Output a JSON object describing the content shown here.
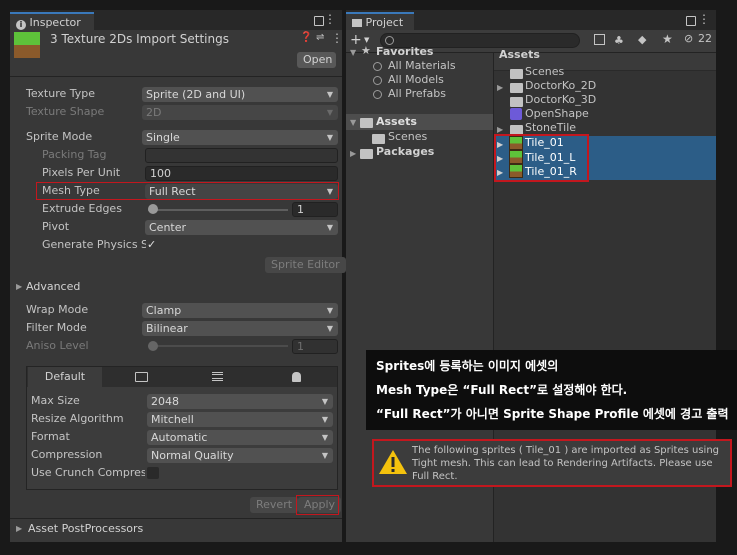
{
  "inspector": {
    "tab_label": "Inspector",
    "header_title": "3 Texture 2Ds Import Settings",
    "open_button": "Open",
    "rows": {
      "texture_type": {
        "label": "Texture Type",
        "value": "Sprite (2D and UI)"
      },
      "texture_shape": {
        "label": "Texture Shape",
        "value": "2D"
      },
      "sprite_mode": {
        "label": "Sprite Mode",
        "value": "Single"
      },
      "packing_tag": {
        "label": "Packing Tag",
        "value": ""
      },
      "pixels_per_unit": {
        "label": "Pixels Per Unit",
        "value": "100"
      },
      "mesh_type": {
        "label": "Mesh Type",
        "value": "Full Rect"
      },
      "extrude_edges": {
        "label": "Extrude Edges",
        "value": "1",
        "slider_fraction": 0.0
      },
      "pivot": {
        "label": "Pivot",
        "value": "Center"
      },
      "generate_physics": {
        "label": "Generate Physics S",
        "checked": true
      }
    },
    "sprite_editor_button": "Sprite Editor",
    "advanced_label": "Advanced",
    "wrap_mode": {
      "label": "Wrap Mode",
      "value": "Clamp"
    },
    "filter_mode": {
      "label": "Filter Mode",
      "value": "Bilinear"
    },
    "aniso_level": {
      "label": "Aniso Level",
      "value": "1",
      "slider_fraction": 0.0
    },
    "platform_tabs": {
      "default_label": "Default",
      "icons": [
        "monitor-icon",
        "server-icon",
        "android-icon"
      ]
    },
    "max_size": {
      "label": "Max Size",
      "value": "2048"
    },
    "resize_algorithm": {
      "label": "Resize Algorithm",
      "value": "Mitchell"
    },
    "format": {
      "label": "Format",
      "value": "Automatic"
    },
    "compression": {
      "label": "Compression",
      "value": "Normal Quality"
    },
    "crunch": {
      "label": "Use Crunch Compress",
      "checked": false
    },
    "revert_button": "Revert",
    "apply_button": "Apply",
    "post_processors_label": "Asset PostProcessors"
  },
  "project": {
    "tab_label": "Project",
    "add_label": "+",
    "hidden_count": "22",
    "favorites": {
      "title": "Favorites",
      "items": [
        "All Materials",
        "All Models",
        "All Prefabs"
      ]
    },
    "tree": {
      "assets": "Assets",
      "scenes": "Scenes",
      "packages": "Packages"
    },
    "breadcrumb": "Assets",
    "asset_list": [
      {
        "name": "Scenes",
        "kind": "folder"
      },
      {
        "name": "DoctorKo_2D",
        "kind": "folder"
      },
      {
        "name": "DoctorKo_3D",
        "kind": "folder"
      },
      {
        "name": "OpenShape",
        "kind": "shape"
      },
      {
        "name": "StoneTile",
        "kind": "folder"
      },
      {
        "name": "Tile_01",
        "kind": "sprite"
      },
      {
        "name": "Tile_01_L",
        "kind": "sprite"
      },
      {
        "name": "Tile_01_R",
        "kind": "sprite"
      }
    ]
  },
  "annotation": {
    "line1": "Sprites에 등록하는 이미지 에셋의",
    "line2": "Mesh Type은 “Full Rect”로 설정해야 한다.",
    "line3": "“Full Rect”가 아니면 Sprite Shape Profile 에셋에 경고 출력"
  },
  "warning": {
    "message": "The following sprites ( Tile_01 ) are imported as Sprites using Tight mesh. This can lead to Rendering Artifacts. Please use Full Rect."
  },
  "colors": {
    "highlight_red": "#c3171e",
    "selection_blue": "#2c5d87",
    "tab_accent": "#3a79bb"
  }
}
